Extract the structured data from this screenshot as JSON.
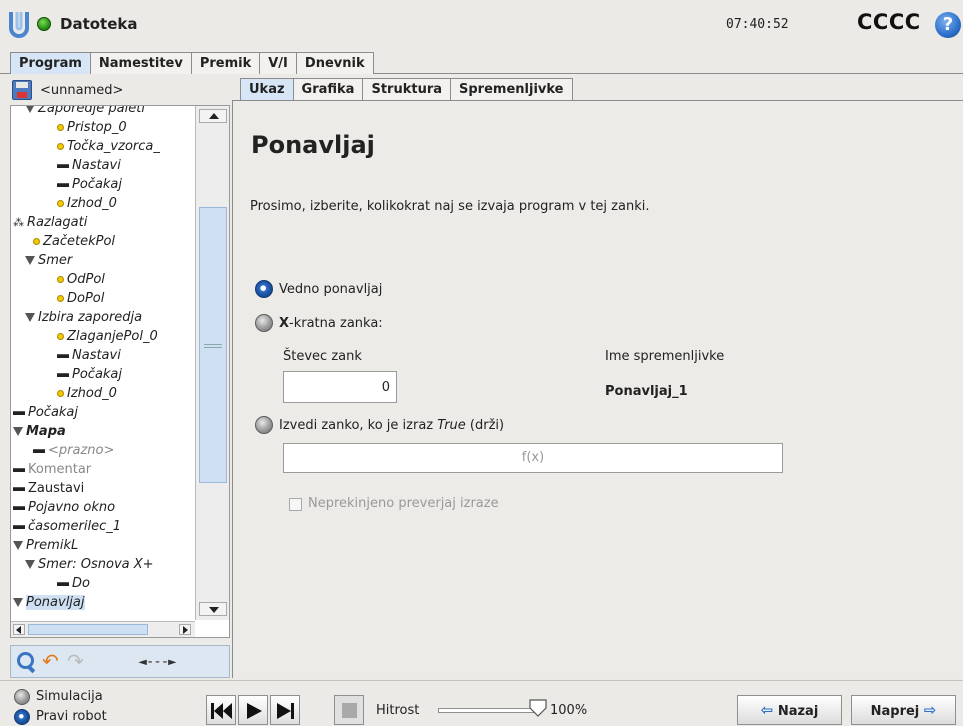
{
  "header": {
    "app_title": "Datoteka",
    "clock": "07:40:52",
    "robot_name": "CCCC",
    "help_symbol": "?"
  },
  "main_tabs": [
    {
      "label": "Program",
      "active": true
    },
    {
      "label": "Namestitev",
      "active": false
    },
    {
      "label": "Premik",
      "active": false
    },
    {
      "label": "V/I",
      "active": false
    },
    {
      "label": "Dnevnik",
      "active": false
    }
  ],
  "program": {
    "file_name": "<unnamed>"
  },
  "tree": [
    {
      "label": "Zaporedje paleti",
      "icon": "triangle"
    },
    {
      "label": "Pristop_0",
      "icon": "dot"
    },
    {
      "label": "Točka_vzorca_",
      "icon": "dot"
    },
    {
      "label": "Nastavi",
      "icon": "dash"
    },
    {
      "label": "Počakaj",
      "icon": "dash"
    },
    {
      "label": "Izhod_0",
      "icon": "dot"
    },
    {
      "label": "Razlagati",
      "icon": "split"
    },
    {
      "label": "ZačetekPol",
      "icon": "dot"
    },
    {
      "label": "Smer",
      "icon": "triangle"
    },
    {
      "label": "OdPol",
      "icon": "dot"
    },
    {
      "label": "DoPol",
      "icon": "dot"
    },
    {
      "label": "Izbira zaporedja",
      "icon": "triangle"
    },
    {
      "label": "ZlaganjePol_0",
      "icon": "dot"
    },
    {
      "label": "Nastavi",
      "icon": "dash"
    },
    {
      "label": "Počakaj",
      "icon": "dash"
    },
    {
      "label": "Izhod_0",
      "icon": "dot"
    },
    {
      "label": "Počakaj",
      "icon": "dash"
    },
    {
      "label": "Mapa",
      "icon": "triangle"
    },
    {
      "label": "<prazno>",
      "icon": "dash"
    },
    {
      "label": "Komentar",
      "icon": "dash"
    },
    {
      "label": "Zaustavi",
      "icon": "dash"
    },
    {
      "label": "Pojavno okno",
      "icon": "dash"
    },
    {
      "label": "časomerilec_1",
      "icon": "dash"
    },
    {
      "label": "PremikL",
      "icon": "triangle"
    },
    {
      "label": "Smer: Osnova X+",
      "icon": "triangle"
    },
    {
      "label": "Do",
      "icon": "dash"
    },
    {
      "label": "Ponavljaj",
      "icon": "triangle",
      "selected": true
    }
  ],
  "tree_tools": {
    "move_label": "◄---►"
  },
  "sub_tabs": [
    {
      "label": "Ukaz",
      "active": true
    },
    {
      "label": "Grafika",
      "active": false
    },
    {
      "label": "Struktura",
      "active": false
    },
    {
      "label": "Spremenljivke",
      "active": false
    }
  ],
  "command": {
    "title": "Ponavljaj",
    "description": "Prosimo, izberite, kolikokrat naj se izvaja program v tej zanki.",
    "option_always": "Vedno ponavljaj",
    "option_x_bold": "X",
    "option_x_rest": "-kratna zanka:",
    "loop_counter_label": "Števec zank",
    "loop_counter_value": "0",
    "var_name_label": "Ime spremenljivke",
    "var_name_value": "Ponavljaj_1",
    "option_expr_prefix": "Izvedi zanko, ko je izraz ",
    "option_expr_italic": "True",
    "option_expr_suffix": " (drži)",
    "expr_placeholder": "f(x)",
    "continuous_check_label": "Neprekinjeno preverjaj izraze",
    "selected_option": "always"
  },
  "bottom": {
    "simulation_label": "Simulacija",
    "real_robot_label": "Pravi robot",
    "speed_label": "Hitrost",
    "speed_value": "100%",
    "speed_fraction": 1.0,
    "back_label": "Nazaj",
    "next_label": "Naprej"
  },
  "colors": {
    "active_tab": "#d7e6f6",
    "accent_blue": "#2c6fc9",
    "status_green": "#2f9a1a"
  }
}
